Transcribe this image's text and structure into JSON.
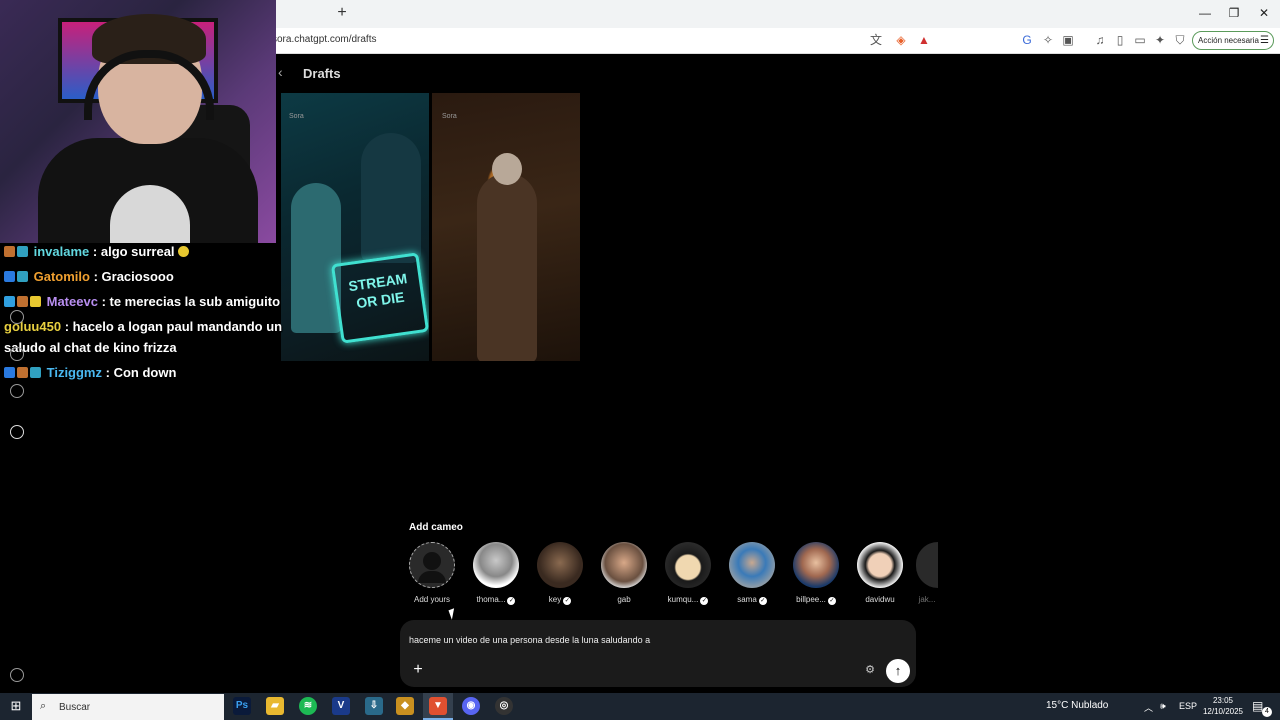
{
  "browser": {
    "new_tab_label": "+",
    "url": "sora.chatgpt.com/drafts",
    "action_button": "Acción necesaria",
    "window_controls": [
      "—",
      "❐",
      "✕"
    ]
  },
  "page": {
    "back_label": "‹",
    "title": "Drafts",
    "drafts": [
      {
        "watermark": "Sora",
        "sign_text": "STREAM OR DIE"
      },
      {
        "watermark": "Sora"
      }
    ]
  },
  "chat": {
    "messages": [
      {
        "user": "invalame",
        "user_color": "#62d8e0",
        "text": ": algo surreal"
      },
      {
        "user": "Gatomilo",
        "user_color": "#f0a030",
        "text": ": Graciosooo"
      },
      {
        "user": "Mateevc",
        "user_color": "#b88ef0",
        "text": ": te merecias la sub amiguito"
      },
      {
        "user": "goluu450",
        "user_color": "#e8d040",
        "text": ": hacelo a logan paul mandando un saludo al chat de kino frizza"
      },
      {
        "user": "Tiziggmz",
        "user_color": "#4ab8f0",
        "text": ": Con down"
      }
    ]
  },
  "cameo": {
    "title": "Add cameo",
    "items": [
      {
        "name": "Add yours",
        "verified": false
      },
      {
        "name": "thoma...",
        "verified": true
      },
      {
        "name": "key",
        "verified": true
      },
      {
        "name": "gab",
        "verified": false
      },
      {
        "name": "kumqu...",
        "verified": true
      },
      {
        "name": "sama",
        "verified": true
      },
      {
        "name": "billpee...",
        "verified": true
      },
      {
        "name": "davidwu",
        "verified": false
      },
      {
        "name": "jak...",
        "verified": false
      }
    ]
  },
  "prompt": {
    "text": "haceme un video de una persona desde la luna saludando a",
    "plus_label": "+",
    "settings_label": "⚙",
    "send_label": "↑"
  },
  "taskbar": {
    "search_label": "Buscar",
    "weather": "15°C  Nublado",
    "language": "ESP",
    "time": "23:05",
    "date": "12/10/2025",
    "notif_count": "4"
  }
}
